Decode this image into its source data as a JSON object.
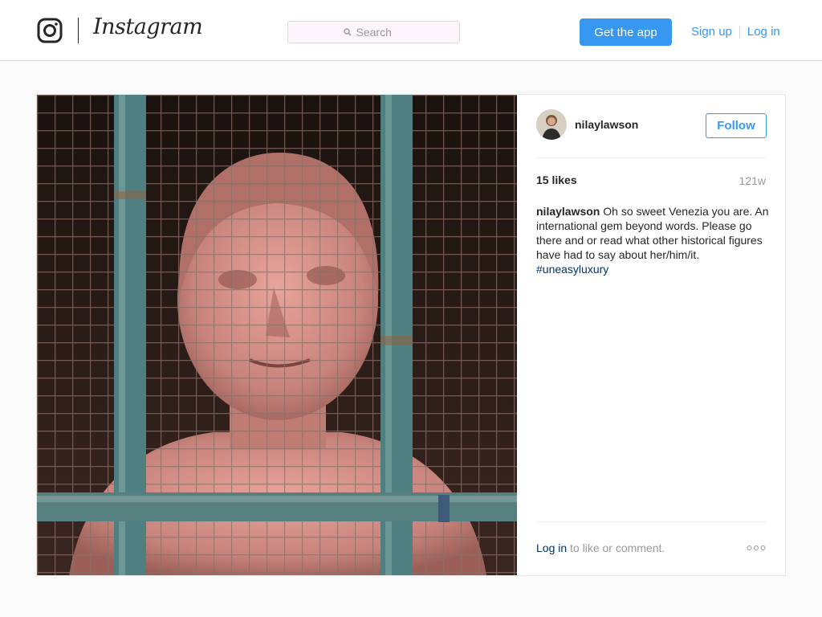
{
  "header": {
    "logo_icon": "camera-outline-icon",
    "brand": "Instagram",
    "search": {
      "placeholder": "Search",
      "icon": "search-icon"
    },
    "get_app_label": "Get the app",
    "signup_label": "Sign up",
    "login_label": "Log in"
  },
  "post": {
    "author": "nilaylawson",
    "follow_label": "Follow",
    "likes": "15 likes",
    "age": "121w",
    "caption": {
      "user": "nilaylawson",
      "text": "Oh so sweet Venezia you are. An international gem beyond words. Please go there and or read what other historical figures have had to say about her/him/it.",
      "hashtag": "#uneasyluxury"
    },
    "footer": {
      "login_link": "Log in",
      "rest": "to like or comment."
    },
    "more_icon": "more-options-icon"
  },
  "colors": {
    "accent": "#3897f0",
    "link_dark": "#003569",
    "border": "#dbdbdb",
    "background": "#fafafa"
  }
}
